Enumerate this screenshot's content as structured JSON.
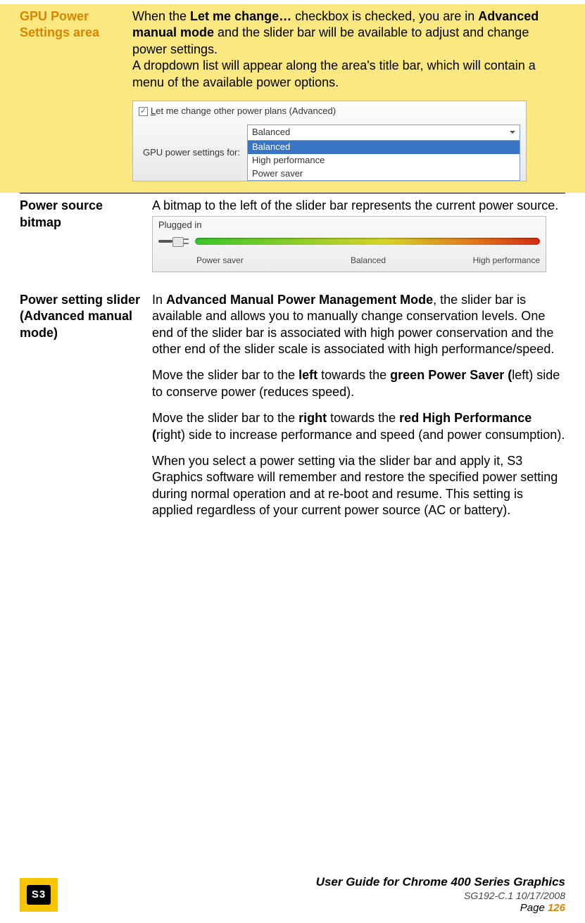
{
  "rows": {
    "r1": {
      "label": "GPU Power Settings area",
      "text_pre": "When the ",
      "bold1": "Let me change…",
      "text_mid1": " checkbox is checked, you are in ",
      "bold2": "Advanced manual mode",
      "text_mid2": " and the slider bar will be available to adjust and change power settings.",
      "text2": "A dropdown list will appear along the area's title bar, which will contain a menu of the available power options."
    },
    "r2": {
      "label": "Power source bitmap",
      "text": "A bitmap to the left of the slider bar represents the current power source."
    },
    "r3": {
      "label": "Power setting slider (Advanced manual mode)",
      "p1_pre": "In ",
      "p1_bold": "Advanced Manual Power Management Mode",
      "p1_post": ", the slider bar is available and allows you to manually change conservation levels. One end of the slider bar is associated with high power conservation and the other end of the slider scale is associated with high performance/speed.",
      "p2_pre": "Move the slider bar to the ",
      "p2_b1": "left",
      "p2_mid": " towards the ",
      "p2_b2": "green Power Saver (",
      "p2_post": "left) side to conserve power (reduces speed).",
      "p3_pre": "Move the slider bar to the ",
      "p3_b1": "right",
      "p3_mid": " towards the ",
      "p3_b2": "red High Performance (",
      "p3_post": "right) side to increase performance and speed (and power consumption).",
      "p4": "When you select a power setting via the slider bar and apply it, S3 Graphics software will remember and restore the specified power setting during normal operation and at re-boot and resume. This setting is applied regardless of your current power source (AC or battery)."
    }
  },
  "shot1": {
    "checkbox_label_u": "L",
    "checkbox_label_rest": "et me change other power plans (Advanced)",
    "field_label": "GPU power settings for:",
    "selected": "Balanced",
    "options": [
      "Balanced",
      "High performance",
      "Power saver"
    ]
  },
  "shot2": {
    "status": "Plugged in",
    "labels": [
      "Power saver",
      "Balanced",
      "High performance"
    ]
  },
  "footer": {
    "logo_text": "S3",
    "title": "User Guide for Chrome 400 Series Graphics",
    "doc": "SG192-C.1   10/17/2008",
    "page_label": "Page ",
    "page_num": "126"
  }
}
